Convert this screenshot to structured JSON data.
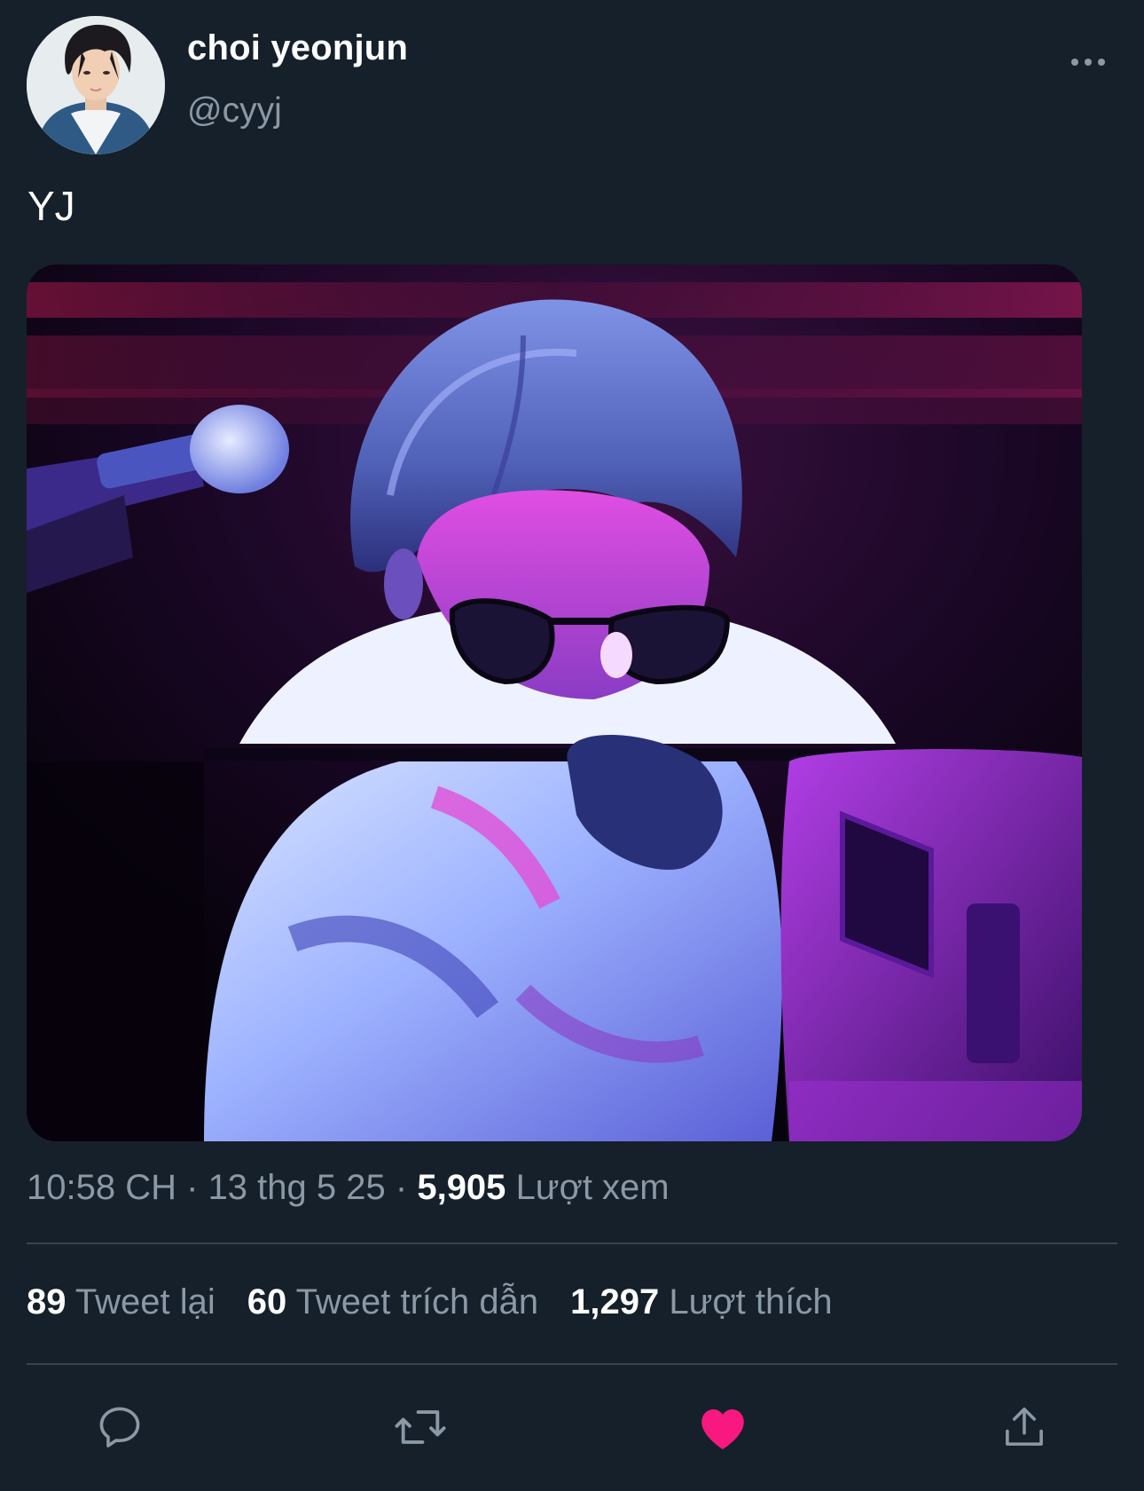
{
  "author": {
    "display_name": "choi yeonjun",
    "handle": "@cyyj",
    "avatar_icon": "profile-photo"
  },
  "header": {
    "more_icon": "more-horizontal-icon"
  },
  "tweet": {
    "text": "YJ",
    "media_description": "photo"
  },
  "meta": {
    "time": "10:58 CH",
    "separator": "·",
    "date": "13 thg 5 25",
    "views_count": "5,905",
    "views_label": "Lượt xem"
  },
  "stats": {
    "retweets_count": "89",
    "retweets_label": "Tweet lại",
    "quotes_count": "60",
    "quotes_label": "Tweet trích dẫn",
    "likes_count": "1,297",
    "likes_label": "Lượt thích"
  },
  "actions": {
    "reply_icon": "reply-icon",
    "retweet_icon": "retweet-icon",
    "like_icon": "heart-icon",
    "share_icon": "share-icon",
    "liked": true,
    "like_color": "#f91880",
    "icon_color": "#8b98a5"
  },
  "colors": {
    "background": "#15202b",
    "text_primary": "#ffffff",
    "text_secondary": "#8b98a5",
    "divider": "#38444d"
  }
}
